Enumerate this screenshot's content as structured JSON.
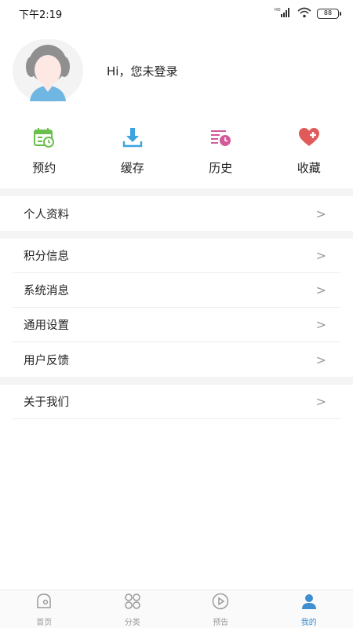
{
  "status_bar": {
    "time": "下午2:19",
    "battery": "88",
    "network_label": "HD"
  },
  "profile": {
    "greeting": "Hi，您未登录"
  },
  "quick_actions": [
    {
      "label": "预约",
      "icon": "calendar-clock-icon",
      "color": "#6bbf4f"
    },
    {
      "label": "缓存",
      "icon": "download-icon",
      "color": "#3aa3e0"
    },
    {
      "label": "历史",
      "icon": "history-list-icon",
      "color": "#d35a9b"
    },
    {
      "label": "收藏",
      "icon": "heart-plus-icon",
      "color": "#e15a5a"
    }
  ],
  "menu": {
    "profile_info": "个人资料",
    "points": "积分信息",
    "messages": "系统消息",
    "settings": "通用设置",
    "feedback": "用户反馈",
    "about": "关于我们",
    "arrow": ">"
  },
  "bottom_nav": [
    {
      "label": "首页",
      "icon": "home-icon",
      "active": false
    },
    {
      "label": "分类",
      "icon": "category-icon",
      "active": false
    },
    {
      "label": "预告",
      "icon": "play-icon",
      "active": false
    },
    {
      "label": "我的",
      "icon": "user-icon",
      "active": true
    }
  ],
  "colors": {
    "accent": "#3e8fd0",
    "inactive": "#9b9b9b",
    "separator": "#f4f4f4"
  }
}
